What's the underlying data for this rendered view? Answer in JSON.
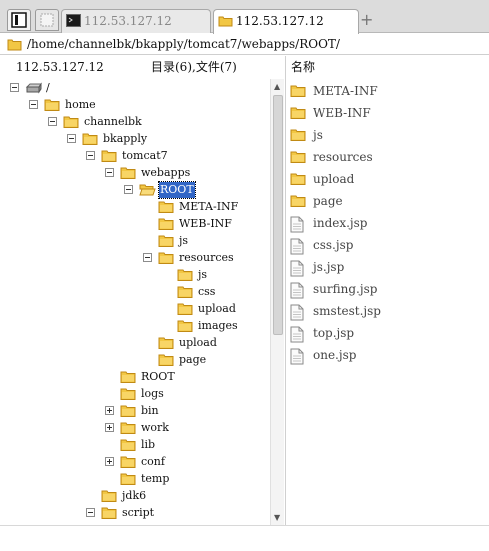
{
  "tabs": [
    {
      "label": "112.53.127.12",
      "active": false,
      "icon": "terminal-icon"
    },
    {
      "label": "112.53.127.12",
      "active": true,
      "icon": "folder-icon"
    }
  ],
  "path": "/home/channelbk/bkapply/tomcat7/webapps/ROOT/",
  "left_header": {
    "host": "112.53.127.12",
    "summary": "目录(6),文件(7)"
  },
  "right_header": {
    "name_col": "名称"
  },
  "tree": [
    {
      "label": "/",
      "depth": 0,
      "state": "open",
      "icon": "drive-icon"
    },
    {
      "label": "home",
      "depth": 1,
      "state": "open",
      "icon": "folder-icon"
    },
    {
      "label": "channelbk",
      "depth": 2,
      "state": "open",
      "icon": "folder-icon"
    },
    {
      "label": "bkapply",
      "depth": 3,
      "state": "open",
      "icon": "folder-icon"
    },
    {
      "label": "tomcat7",
      "depth": 4,
      "state": "open",
      "icon": "folder-icon"
    },
    {
      "label": "webapps",
      "depth": 5,
      "state": "open",
      "icon": "folder-icon"
    },
    {
      "label": "ROOT",
      "depth": 6,
      "state": "open",
      "icon": "folder-open-icon",
      "selected": true
    },
    {
      "label": "META-INF",
      "depth": 7,
      "state": "none",
      "icon": "folder-icon"
    },
    {
      "label": "WEB-INF",
      "depth": 7,
      "state": "none",
      "icon": "folder-icon"
    },
    {
      "label": "js",
      "depth": 7,
      "state": "none",
      "icon": "folder-icon"
    },
    {
      "label": "resources",
      "depth": 7,
      "state": "open",
      "icon": "folder-icon"
    },
    {
      "label": "js",
      "depth": 8,
      "state": "none",
      "icon": "folder-icon"
    },
    {
      "label": "css",
      "depth": 8,
      "state": "none",
      "icon": "folder-icon"
    },
    {
      "label": "upload",
      "depth": 8,
      "state": "none",
      "icon": "folder-icon"
    },
    {
      "label": "images",
      "depth": 8,
      "state": "none",
      "icon": "folder-icon"
    },
    {
      "label": "upload",
      "depth": 7,
      "state": "none",
      "icon": "folder-icon"
    },
    {
      "label": "page",
      "depth": 7,
      "state": "none",
      "icon": "folder-icon"
    },
    {
      "label": "ROOT",
      "depth": 5,
      "state": "none",
      "icon": "folder-icon"
    },
    {
      "label": "logs",
      "depth": 5,
      "state": "none",
      "icon": "folder-icon"
    },
    {
      "label": "bin",
      "depth": 5,
      "state": "closed",
      "icon": "folder-icon"
    },
    {
      "label": "work",
      "depth": 5,
      "state": "closed",
      "icon": "folder-icon"
    },
    {
      "label": "lib",
      "depth": 5,
      "state": "none",
      "icon": "folder-icon"
    },
    {
      "label": "conf",
      "depth": 5,
      "state": "closed",
      "icon": "folder-icon"
    },
    {
      "label": "temp",
      "depth": 5,
      "state": "none",
      "icon": "folder-icon"
    },
    {
      "label": "jdk6",
      "depth": 4,
      "state": "none",
      "icon": "folder-icon"
    },
    {
      "label": "script",
      "depth": 4,
      "state": "open",
      "icon": "folder-icon"
    }
  ],
  "files": [
    {
      "name": "META-INF",
      "type": "folder",
      "icon": "folder-icon"
    },
    {
      "name": "WEB-INF",
      "type": "folder",
      "icon": "folder-icon"
    },
    {
      "name": "js",
      "type": "folder",
      "icon": "folder-icon"
    },
    {
      "name": "resources",
      "type": "folder",
      "icon": "folder-icon"
    },
    {
      "name": "upload",
      "type": "folder",
      "icon": "folder-icon"
    },
    {
      "name": "page",
      "type": "folder",
      "icon": "folder-icon"
    },
    {
      "name": "index.jsp",
      "type": "file",
      "icon": "file-icon"
    },
    {
      "name": "css.jsp",
      "type": "file",
      "icon": "file-icon"
    },
    {
      "name": "js.jsp",
      "type": "file",
      "icon": "file-icon"
    },
    {
      "name": "surfing.jsp",
      "type": "file",
      "icon": "file-icon"
    },
    {
      "name": "smstest.jsp",
      "type": "file",
      "icon": "file-icon"
    },
    {
      "name": "top.jsp",
      "type": "file",
      "icon": "file-icon"
    },
    {
      "name": "one.jsp",
      "type": "file",
      "icon": "file-icon"
    }
  ],
  "colors": {
    "folder": "#f2c744",
    "folder_edge": "#c08a14",
    "selection": "#3166c6"
  }
}
